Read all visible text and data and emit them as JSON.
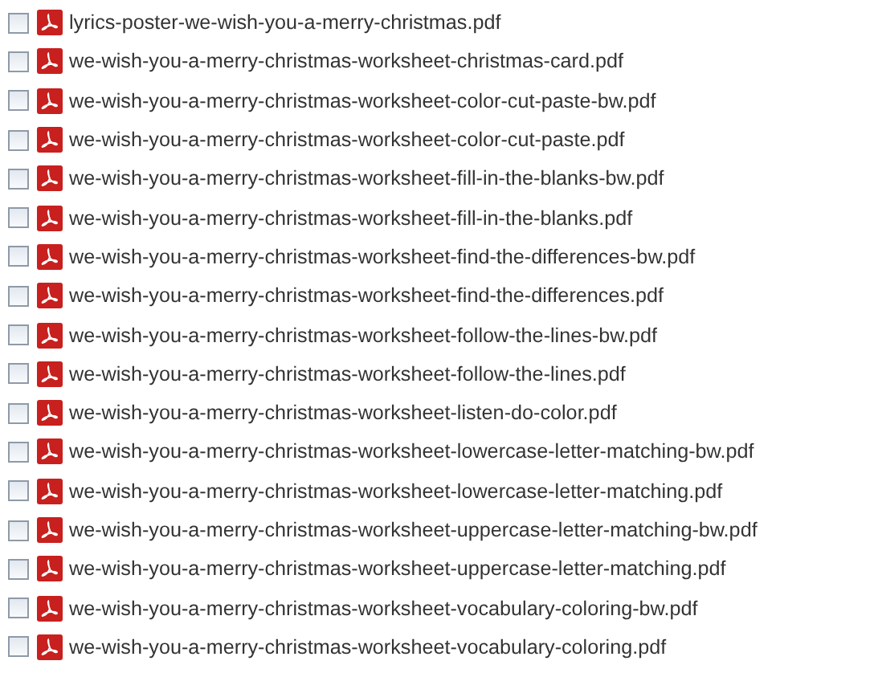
{
  "files": [
    {
      "name": "lyrics-poster-we-wish-you-a-merry-christmas.pdf",
      "checked": false
    },
    {
      "name": "we-wish-you-a-merry-christmas-worksheet-christmas-card.pdf",
      "checked": false
    },
    {
      "name": "we-wish-you-a-merry-christmas-worksheet-color-cut-paste-bw.pdf",
      "checked": false
    },
    {
      "name": "we-wish-you-a-merry-christmas-worksheet-color-cut-paste.pdf",
      "checked": false
    },
    {
      "name": "we-wish-you-a-merry-christmas-worksheet-fill-in-the-blanks-bw.pdf",
      "checked": false
    },
    {
      "name": "we-wish-you-a-merry-christmas-worksheet-fill-in-the-blanks.pdf",
      "checked": false
    },
    {
      "name": "we-wish-you-a-merry-christmas-worksheet-find-the-differences-bw.pdf",
      "checked": false
    },
    {
      "name": "we-wish-you-a-merry-christmas-worksheet-find-the-differences.pdf",
      "checked": false
    },
    {
      "name": "we-wish-you-a-merry-christmas-worksheet-follow-the-lines-bw.pdf",
      "checked": false
    },
    {
      "name": "we-wish-you-a-merry-christmas-worksheet-follow-the-lines.pdf",
      "checked": false
    },
    {
      "name": "we-wish-you-a-merry-christmas-worksheet-listen-do-color.pdf",
      "checked": false
    },
    {
      "name": "we-wish-you-a-merry-christmas-worksheet-lowercase-letter-matching-bw.pdf",
      "checked": false
    },
    {
      "name": "we-wish-you-a-merry-christmas-worksheet-lowercase-letter-matching.pdf",
      "checked": false
    },
    {
      "name": "we-wish-you-a-merry-christmas-worksheet-uppercase-letter-matching-bw.pdf",
      "checked": false
    },
    {
      "name": "we-wish-you-a-merry-christmas-worksheet-uppercase-letter-matching.pdf",
      "checked": false
    },
    {
      "name": "we-wish-you-a-merry-christmas-worksheet-vocabulary-coloring-bw.pdf",
      "checked": false
    },
    {
      "name": "we-wish-you-a-merry-christmas-worksheet-vocabulary-coloring.pdf",
      "checked": false
    }
  ]
}
